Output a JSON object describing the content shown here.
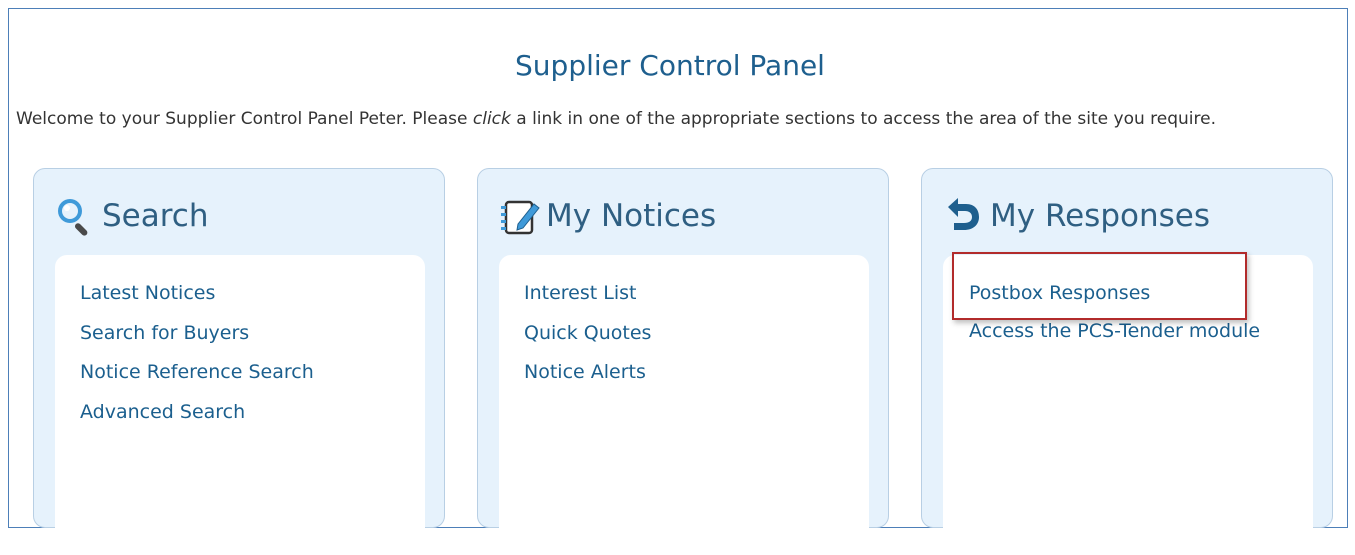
{
  "page": {
    "title": "Supplier Control Panel",
    "welcome_before": "Welcome to your Supplier Control Panel Peter. Please ",
    "welcome_em": "click",
    "welcome_after": " a link in one of the appropriate sections to access the area of the site you require."
  },
  "panels": [
    {
      "title": "Search",
      "icon": "search-icon",
      "links": [
        "Latest Notices",
        "Search for Buyers",
        "Notice Reference Search",
        "Advanced Search"
      ]
    },
    {
      "title": "My Notices",
      "icon": "notice-edit-icon",
      "links": [
        "Interest List",
        "Quick Quotes",
        "Notice Alerts"
      ]
    },
    {
      "title": "My Responses",
      "icon": "reply-arrow-icon",
      "links": [
        "Postbox Responses",
        "Access the PCS-Tender module"
      ]
    }
  ],
  "colors": {
    "title": "#1e5f8e",
    "link": "#1b5f8e",
    "panel_bg": "#e6f2fc",
    "highlight_border": "#b22b2b"
  }
}
